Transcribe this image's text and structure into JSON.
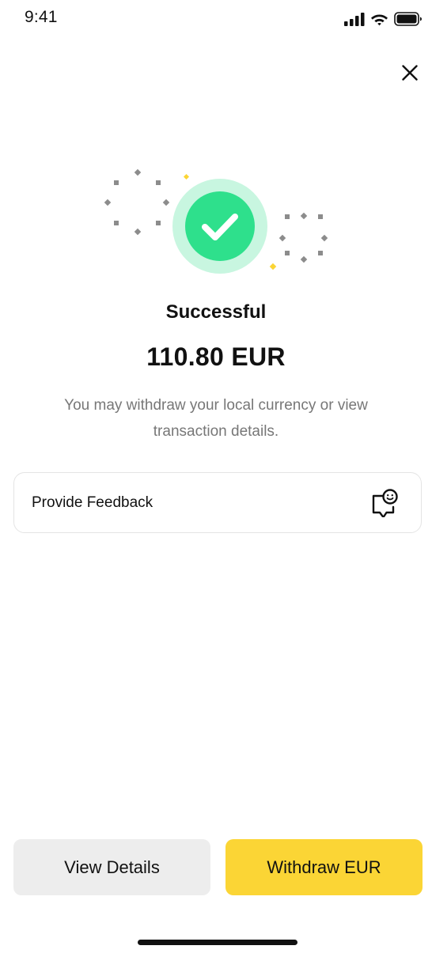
{
  "status_bar": {
    "time": "9:41"
  },
  "result": {
    "title": "Successful",
    "amount": "110.80 EUR",
    "description": "You may withdraw your local currency or view transaction details."
  },
  "feedback": {
    "label": "Provide Feedback",
    "icon": "feedback-chat-smile-icon"
  },
  "actions": {
    "secondary_label": "View Details",
    "primary_label": "Withdraw EUR"
  },
  "colors": {
    "accent_yellow": "#fbd535",
    "success_green": "#2ee08c",
    "success_halo": "#c8f6e0",
    "secondary_button": "#ededed"
  }
}
